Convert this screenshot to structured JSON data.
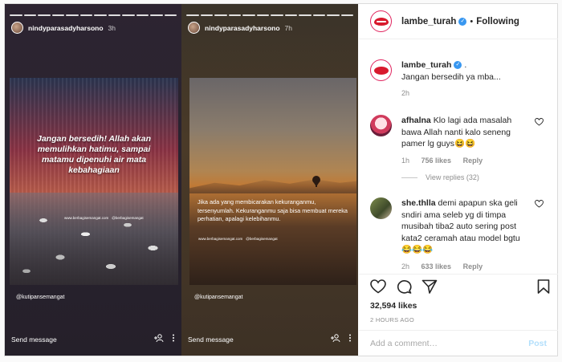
{
  "stories": [
    {
      "username": "nindyparasadyharsono",
      "time": "3h",
      "quote": "Jangan bersedih! Allah akan memulihkan hatimu, sampai matamu dipenuhi air mata kebahagiaan",
      "site": "www.berbagisemangat.com",
      "handle": "@berbagisemangat",
      "tag": "@kutipansemangat",
      "send_placeholder": "Send message"
    },
    {
      "username": "nindyparasadyharsono",
      "time": "7h",
      "quote": "Jika ada yang membicarakan kekuranganmu, tersenyumlah. Kekuranganmu saja bisa membuat mereka perhatian, apalagi kelebihanmu.",
      "site": "www.berbagisemangat.com",
      "handle": "@berbagisemangat",
      "tag": "@kutipansemangat",
      "send_placeholder": "Send message"
    }
  ],
  "header": {
    "username": "lambe_turah",
    "verified_icon": "verified-badge-icon",
    "separator": "•",
    "follow_label": "Following"
  },
  "caption": {
    "username": "lambe_turah",
    "suffix": ".",
    "text": "Jangan bersedih ya mba...",
    "time": "2h"
  },
  "comments": [
    {
      "username": "afhalna",
      "text": "Klo lagi ada masalah bawa Allah nanti kalo seneng pamer lg guys😆😆",
      "time": "1h",
      "likes": "756 likes",
      "reply": "Reply",
      "view_replies": "View replies (32)"
    },
    {
      "username": "she.thlla",
      "text": "demi apapun ska geli sndiri ama seleb yg di timpa musibah tiba2 auto sering post kata2 ceramah atau model bgtu 😂😂😂",
      "time": "2h",
      "likes": "633 likes",
      "reply": "Reply"
    }
  ],
  "actions": {
    "likes": "32,594 likes",
    "posted_ago": "2 HOURS AGO"
  },
  "add_comment": {
    "placeholder": "Add a comment…",
    "post_label": "Post"
  },
  "colors": {
    "accent": "#3897f0",
    "post_button": "#b2dffc",
    "brand_red": "#d8192d"
  }
}
